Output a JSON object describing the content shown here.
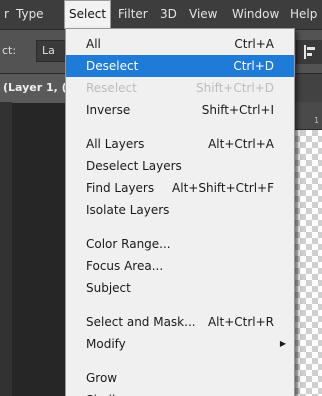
{
  "menubar": {
    "items": [
      "r",
      "Type",
      "Select",
      "Filter",
      "3D",
      "View",
      "Window",
      "Help"
    ],
    "active": "Select"
  },
  "options_bar": {
    "select_label": "ct:",
    "field_value": "La",
    "right_icon": "align-icon"
  },
  "document_tab": {
    "label": "(Layer 1, ("
  },
  "ruler": {
    "tick": "1"
  },
  "select_menu": {
    "groups": [
      [
        {
          "label": "All",
          "shortcut": "Ctrl+A"
        },
        {
          "label": "Deselect",
          "shortcut": "Ctrl+D",
          "highlighted": true
        },
        {
          "label": "Reselect",
          "shortcut": "Shift+Ctrl+D",
          "disabled": true
        },
        {
          "label": "Inverse",
          "shortcut": "Shift+Ctrl+I"
        }
      ],
      [
        {
          "label": "All Layers",
          "shortcut": "Alt+Ctrl+A"
        },
        {
          "label": "Deselect Layers",
          "shortcut": ""
        },
        {
          "label": "Find Layers",
          "shortcut": "Alt+Shift+Ctrl+F"
        },
        {
          "label": "Isolate Layers",
          "shortcut": ""
        }
      ],
      [
        {
          "label": "Color Range...",
          "shortcut": ""
        },
        {
          "label": "Focus Area...",
          "shortcut": ""
        },
        {
          "label": "Subject",
          "shortcut": ""
        }
      ],
      [
        {
          "label": "Select and Mask...",
          "shortcut": "Alt+Ctrl+R"
        },
        {
          "label": "Modify",
          "shortcut": "",
          "submenu": true
        }
      ],
      [
        {
          "label": "Grow",
          "shortcut": ""
        },
        {
          "label": "Similar",
          "shortcut": ""
        }
      ]
    ]
  },
  "colors": {
    "highlight": "#1e7bd8",
    "menu_bg": "#f0f0f0",
    "app_bg": "#262626",
    "disabled_text": "#bcbcbc"
  }
}
